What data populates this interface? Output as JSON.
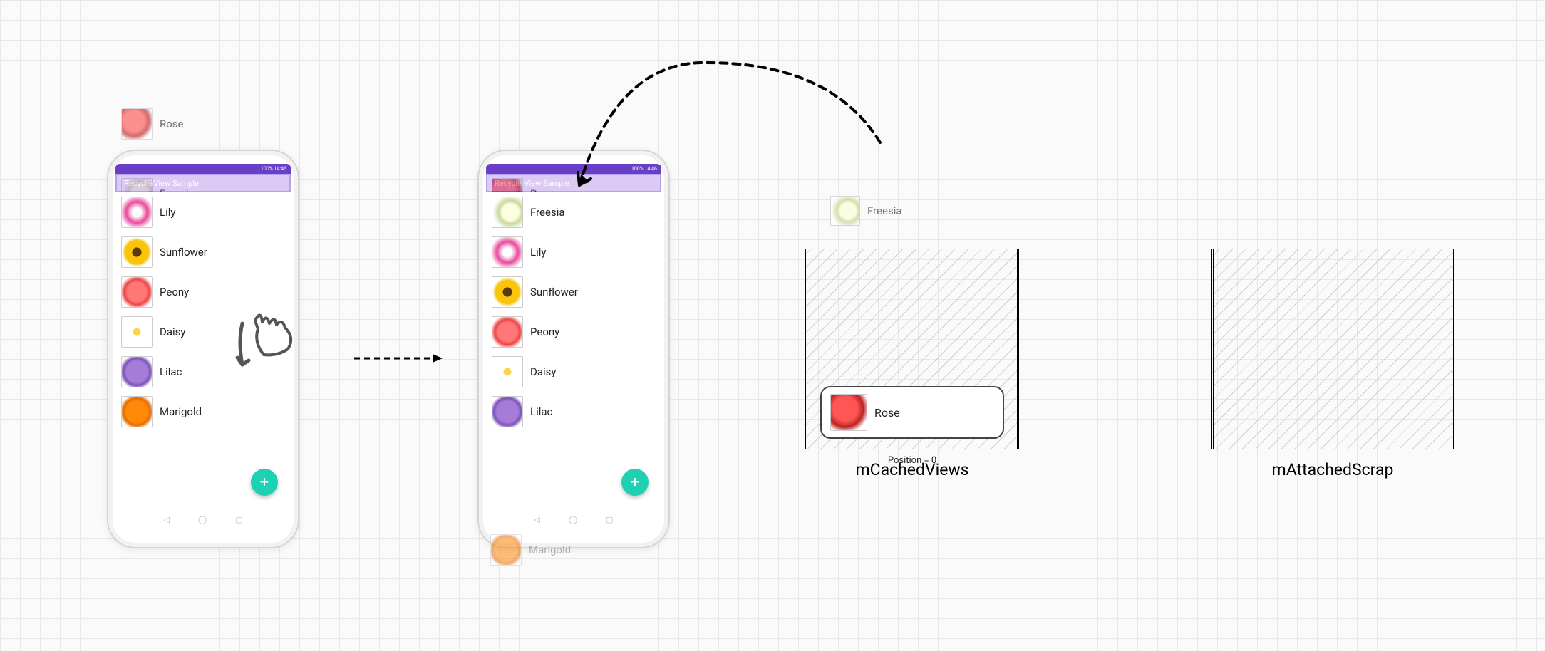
{
  "app": {
    "status_text": "100% 14:46",
    "appbar_title": "RecyclerView Sample",
    "fab_label": "+"
  },
  "phone1": {
    "top_floating": {
      "label": "Rose",
      "icon": "fl-rose"
    },
    "overlay_floating": {
      "label": "Freesia",
      "icon": "fl-freesia"
    },
    "items": [
      {
        "label": "Lily",
        "icon": "fl-lily"
      },
      {
        "label": "Sunflower",
        "icon": "fl-sunflower"
      },
      {
        "label": "Peony",
        "icon": "fl-peony"
      },
      {
        "label": "Daisy",
        "icon": "fl-daisy"
      },
      {
        "label": "Lilac",
        "icon": "fl-lilac"
      },
      {
        "label": "Marigold",
        "icon": "fl-marigold"
      }
    ]
  },
  "phone2": {
    "top_floating": {
      "label": "Rose",
      "icon": "fl-rose"
    },
    "items": [
      {
        "label": "Freesia",
        "icon": "fl-freesia"
      },
      {
        "label": "Lily",
        "icon": "fl-lily"
      },
      {
        "label": "Sunflower",
        "icon": "fl-sunflower"
      },
      {
        "label": "Peony",
        "icon": "fl-peony"
      },
      {
        "label": "Daisy",
        "icon": "fl-daisy"
      },
      {
        "label": "Lilac",
        "icon": "fl-lilac"
      }
    ],
    "bottom_floating": {
      "label": "Marigold",
      "icon": "fl-marigold"
    }
  },
  "caches": {
    "freesia_floating": {
      "label": "Freesia",
      "icon": "fl-freesia"
    },
    "mCachedViews": {
      "title": "mCachedViews",
      "card": {
        "label": "Rose",
        "icon": "fl-rose"
      },
      "position_text": "Position = 0"
    },
    "mAttachedScrap": {
      "title": "mAttachedScrap"
    }
  }
}
